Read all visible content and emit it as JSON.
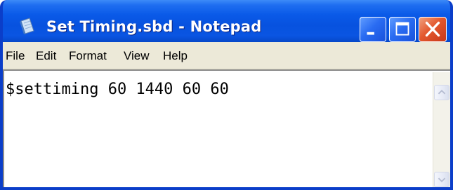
{
  "window": {
    "title": "Set Timing.sbd - Notepad",
    "app_icon": "notepad-icon",
    "controls": {
      "minimize_icon": "minimize-icon",
      "maximize_icon": "maximize-icon",
      "close_icon": "close-icon"
    }
  },
  "menu": {
    "items": [
      {
        "label": "File"
      },
      {
        "label": "Edit"
      },
      {
        "label": "Format"
      },
      {
        "label": "View"
      },
      {
        "label": "Help"
      }
    ]
  },
  "editor": {
    "content": "$settiming 60 1440 60 60"
  },
  "scrollbar": {
    "up_icon": "scroll-up-arrow-icon",
    "down_icon": "scroll-down-arrow-icon"
  },
  "colors": {
    "titlebar": "#0a5ae8",
    "close_button": "#e3582e",
    "menubar": "#ece9d8"
  }
}
